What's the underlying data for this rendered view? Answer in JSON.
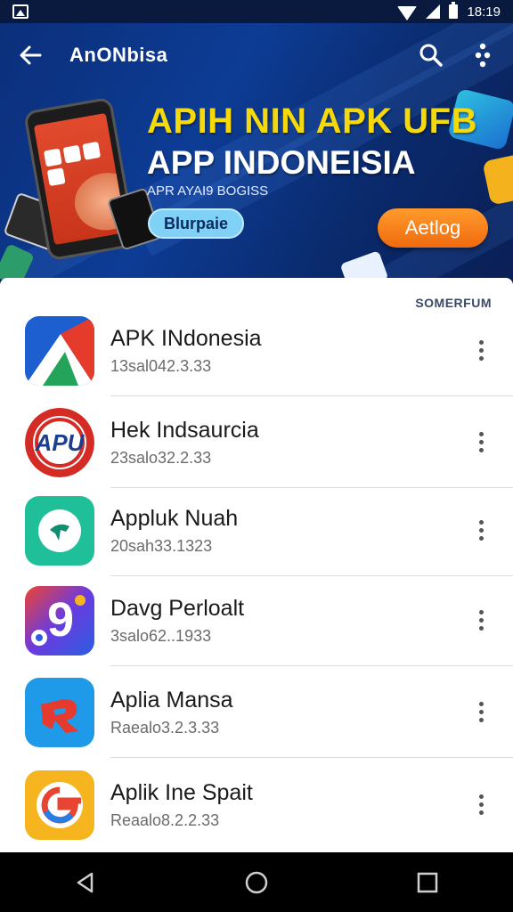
{
  "status_bar": {
    "time": "18:19",
    "icons": [
      "gallery-icon",
      "wifi-icon",
      "signal-icon",
      "battery-icon"
    ]
  },
  "app_bar": {
    "title": "AnONbisa",
    "back_icon": "arrow-left-icon",
    "actions": [
      "search-icon",
      "more-vertical-icon"
    ]
  },
  "banner": {
    "headline": "APIH NIN APK UFB",
    "title": "APP INDONEISIA",
    "subtitle": "APR AYAI9 BOGISS",
    "primary_button": "Blurpaie",
    "secondary_button": "Aetlog"
  },
  "list": {
    "section_action": "SOMERFUM",
    "apps": [
      {
        "name": "APK INdonesia",
        "version": "13sal042.3.33",
        "icon": "apk-indonesia-icon",
        "colors": [
          "#1d5fd1",
          "#e53b2c",
          "#24a35a"
        ]
      },
      {
        "name": "Hek Indsaurcia",
        "version": "23salo32.2.33",
        "icon": "apu-logo-icon",
        "colors": [
          "#d42b25",
          "#1a3f8f",
          "#ffffff"
        ]
      },
      {
        "name": "Appluk Nuah",
        "version": "20sah33.1323",
        "icon": "green-map-icon",
        "colors": [
          "#1fbf9a",
          "#0f8e72",
          "#ffffff"
        ]
      },
      {
        "name": "Davg Perloalt",
        "version": "3salo62..1933",
        "icon": "colorful-nine-icon",
        "colors": [
          "#6b3be0",
          "#f0432f",
          "#f6b51e"
        ]
      },
      {
        "name": "Aplia Mansa",
        "version": "Raealo3.2.3.33",
        "icon": "red-r-icon",
        "colors": [
          "#1f9ae8",
          "#e73a2e",
          "#ffffff"
        ]
      },
      {
        "name": "Aplik Ine Spait",
        "version": "Reaalo8.2.2.33",
        "icon": "google-g-icon",
        "colors": [
          "#f6b51e",
          "#e74432",
          "#2a7de1"
        ]
      }
    ]
  },
  "nav_bar": {
    "buttons": [
      "back-triangle-icon",
      "home-circle-icon",
      "recents-square-icon"
    ]
  }
}
